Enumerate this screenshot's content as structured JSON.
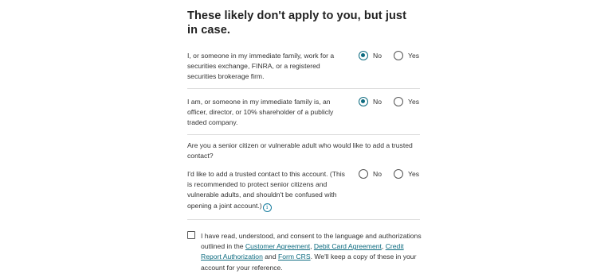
{
  "heading": "These likely don't apply to you, but just in case.",
  "questions": [
    {
      "text": "I, or someone in my immediate family, work for a securities exchange, FINRA, or a registered securities brokerage firm.",
      "options": [
        "No",
        "Yes"
      ],
      "selected": "No"
    },
    {
      "text": "I am, or someone in my immediate family is, an officer, director, or 10% shareholder of a publicly traded company.",
      "options": [
        "No",
        "Yes"
      ],
      "selected": "No"
    }
  ],
  "trusted_contact": {
    "prompt": "Are you a senior citizen or vulnerable adult who would like to add a trusted contact?",
    "text": "I'd like to add a trusted contact to this account. (This is recommended to protect senior citizens and vulnerable adults, and shouldn't be confused with opening a joint account.)",
    "options": [
      "No",
      "Yes"
    ],
    "selected": null,
    "info_icon": "info-icon"
  },
  "consent": {
    "checked": false,
    "text_before": "I have read, understood, and consent to the language and authorizations outlined in the ",
    "link1": "Customer Agreement",
    "sep1": ", ",
    "link2": "Debit Card Agreement",
    "sep2": ", ",
    "link3": "Credit Report Authorization",
    "sep3": " and ",
    "link4": "Form CRS",
    "text_after": ". We'll keep a copy of these in your account for your reference."
  },
  "colors": {
    "accent": "#0d6b80",
    "link": "#0d6b80",
    "divider": "#dddddd"
  }
}
